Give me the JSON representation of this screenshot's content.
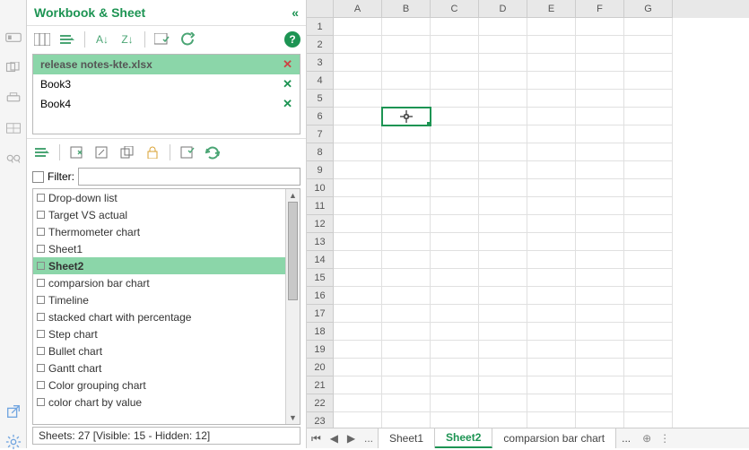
{
  "panel": {
    "title": "Workbook & Sheet",
    "workbooks": [
      {
        "name": "release notes-kte.xlsx",
        "active": true
      },
      {
        "name": "Book3",
        "active": false
      },
      {
        "name": "Book4",
        "active": false
      }
    ],
    "filter_label": "Filter:",
    "filter_value": "",
    "sheets": [
      "Drop-down list",
      "Target VS actual",
      "Thermometer chart",
      "Sheet1",
      "Sheet2",
      "comparsion bar chart",
      "Timeline",
      "stacked chart with percentage",
      "Step chart",
      "Bullet chart",
      "Gantt chart",
      "Color grouping chart",
      "color chart by value"
    ],
    "selected_sheet": "Sheet2",
    "status": "Sheets: 27  [Visible: 15 - Hidden: 12]"
  },
  "grid": {
    "columns": [
      "A",
      "B",
      "C",
      "D",
      "E",
      "F",
      "G"
    ],
    "rows": [
      1,
      2,
      3,
      4,
      5,
      6,
      7,
      8,
      9,
      10,
      11,
      12,
      13,
      14,
      15,
      16,
      17,
      18,
      19,
      20,
      21,
      22,
      23
    ],
    "selected_cell": "B6"
  },
  "tabs": {
    "nav_ellipsis": "...",
    "items": [
      "Sheet1",
      "Sheet2",
      "comparsion bar chart"
    ],
    "active": "Sheet2",
    "overflow": "..."
  }
}
